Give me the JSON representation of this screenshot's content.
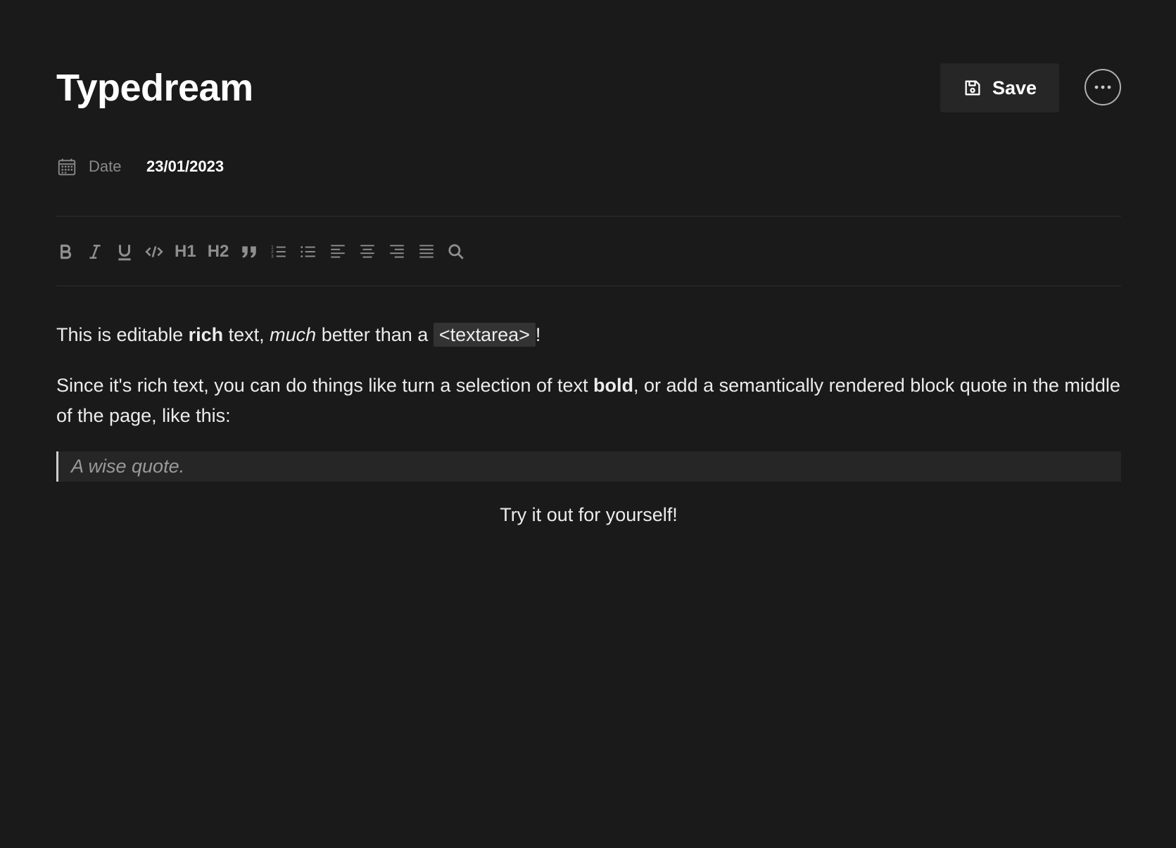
{
  "header": {
    "title": "Typedream",
    "save_label": "Save"
  },
  "meta": {
    "date_label": "Date",
    "date_value": "23/01/2023"
  },
  "toolbar": {
    "h1": "H1",
    "h2": "H2"
  },
  "content": {
    "p1_a": "This is editable ",
    "p1_bold": "rich",
    "p1_b": " text, ",
    "p1_italic": "much",
    "p1_c": " better than a ",
    "p1_code": "<textarea>",
    "p1_d": "!",
    "p2_a": "Since it's rich text, you can do things like turn a selection of text ",
    "p2_bold": "bold",
    "p2_b": ", or add a semantically rendered block quote in the middle of the page, like this:",
    "quote": "A wise quote.",
    "p3": "Try it out for yourself!"
  },
  "colors": {
    "background": "#1a1a1a",
    "button_bg": "#262626",
    "icon_gray": "#8e8e8e"
  }
}
